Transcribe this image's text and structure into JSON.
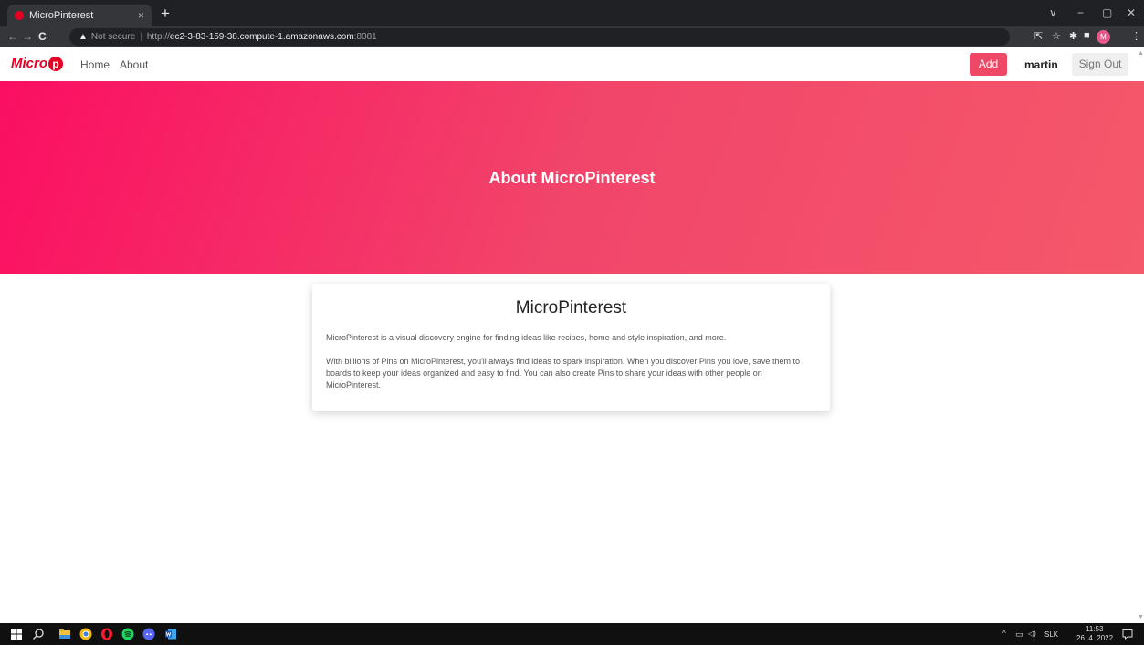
{
  "browser": {
    "tab_title": "MicroPinterest",
    "tab_close": "×",
    "new_tab": "+",
    "back": "←",
    "forward": "→",
    "reload": "C",
    "warning_icon": "▲",
    "not_secure": "Not secure",
    "separator": "|",
    "url_scheme": "http://",
    "url_host": "ec2-3-83-159-38.compute-1.amazonaws.com",
    "url_port": ":8081",
    "profile_initial": "M",
    "window_controls": [
      "∨",
      "−",
      "▢",
      "✕"
    ],
    "extension_icons": [
      "share-icon",
      "star-icon",
      "puzzle-icon",
      "sidepanel-icon"
    ]
  },
  "navbar": {
    "logo_text": "Micro",
    "logo_letter": "p",
    "links": [
      "Home",
      "About"
    ],
    "add_label": "Add",
    "username": "martin",
    "signout_label": "Sign Out"
  },
  "hero": {
    "title": "About MicroPinterest"
  },
  "card": {
    "title": "MicroPinterest",
    "paragraphs": [
      "MicroPinterest is a visual discovery engine for finding ideas like recipes, home and style inspiration, and more.",
      "With billions of Pins on MicroPinterest, you'll always find ideas to spark inspiration. When you discover Pins you love, save them to boards to keep your ideas organized and easy to find. You can also create Pins to share your ideas with other people on MicroPinterest."
    ]
  },
  "taskbar": {
    "apps": [
      "windows-start-icon",
      "search-icon",
      "file-explorer-icon",
      "chrome-icon",
      "opera-icon",
      "spotify-icon",
      "discord-icon",
      "word-icon"
    ],
    "tray_chevron": "^",
    "language": "SLK",
    "time": "11:53",
    "date": "26. 4. 2022"
  },
  "colors": {
    "brand": "#e60023",
    "add_button": "#ef4766",
    "hero_start": "#fb0e62",
    "hero_end": "#f5586a"
  }
}
